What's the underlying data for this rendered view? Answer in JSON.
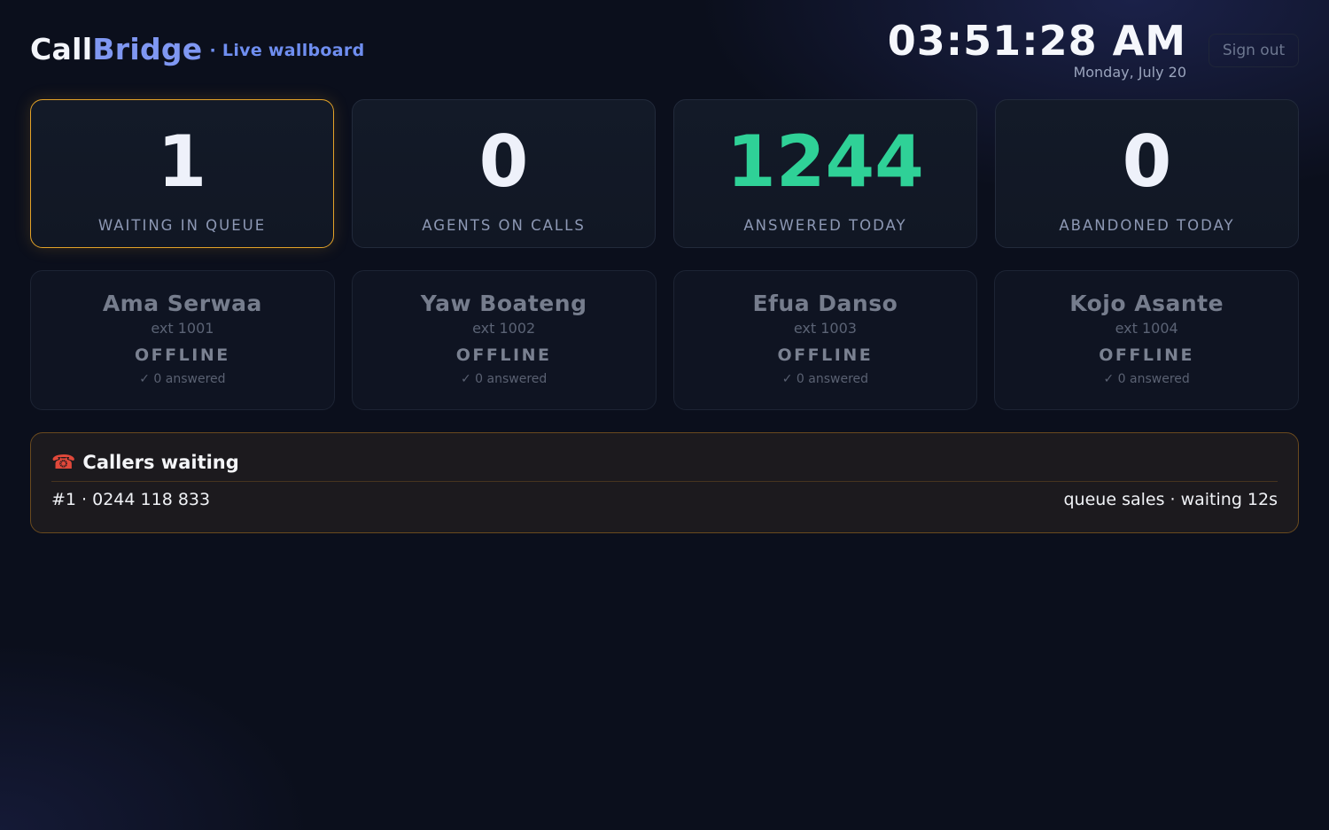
{
  "header": {
    "brand_call": "Call",
    "brand_bridge": "Bridge",
    "brand_sub": "· Live wallboard",
    "time": "03:51:28 AM",
    "date": "Monday, July 20",
    "signout_label": "Sign out"
  },
  "stats": [
    {
      "value": "1",
      "label": "WAITING IN QUEUE",
      "highlight": true
    },
    {
      "value": "0",
      "label": "AGENTS ON CALLS"
    },
    {
      "value": "1244",
      "label": "ANSWERED TODAY",
      "accent": "#2fd197"
    },
    {
      "value": "0",
      "label": "ABANDONED TODAY"
    }
  ],
  "agents": [
    {
      "name": "Ama Serwaa",
      "ext": "ext 1001",
      "status": "OFFLINE",
      "answered": "✓ 0 answered"
    },
    {
      "name": "Yaw Boateng",
      "ext": "ext 1002",
      "status": "OFFLINE",
      "answered": "✓ 0 answered"
    },
    {
      "name": "Efua Danso",
      "ext": "ext 1003",
      "status": "OFFLINE",
      "answered": "✓ 0 answered"
    },
    {
      "name": "Kojo Asante",
      "ext": "ext 1004",
      "status": "OFFLINE",
      "answered": "✓ 0 answered"
    }
  ],
  "queue": {
    "icon": "telephone-icon",
    "title": "Callers waiting",
    "callers": [
      {
        "position_number": "#1 · 0244 118 833",
        "details": "queue sales · waiting 12s"
      }
    ]
  },
  "colors": {
    "highlight_border": "#e3a228",
    "answered_green": "#2fd197",
    "brand_blue": "#7f97f2",
    "queue_border": "#6a4a1e"
  }
}
